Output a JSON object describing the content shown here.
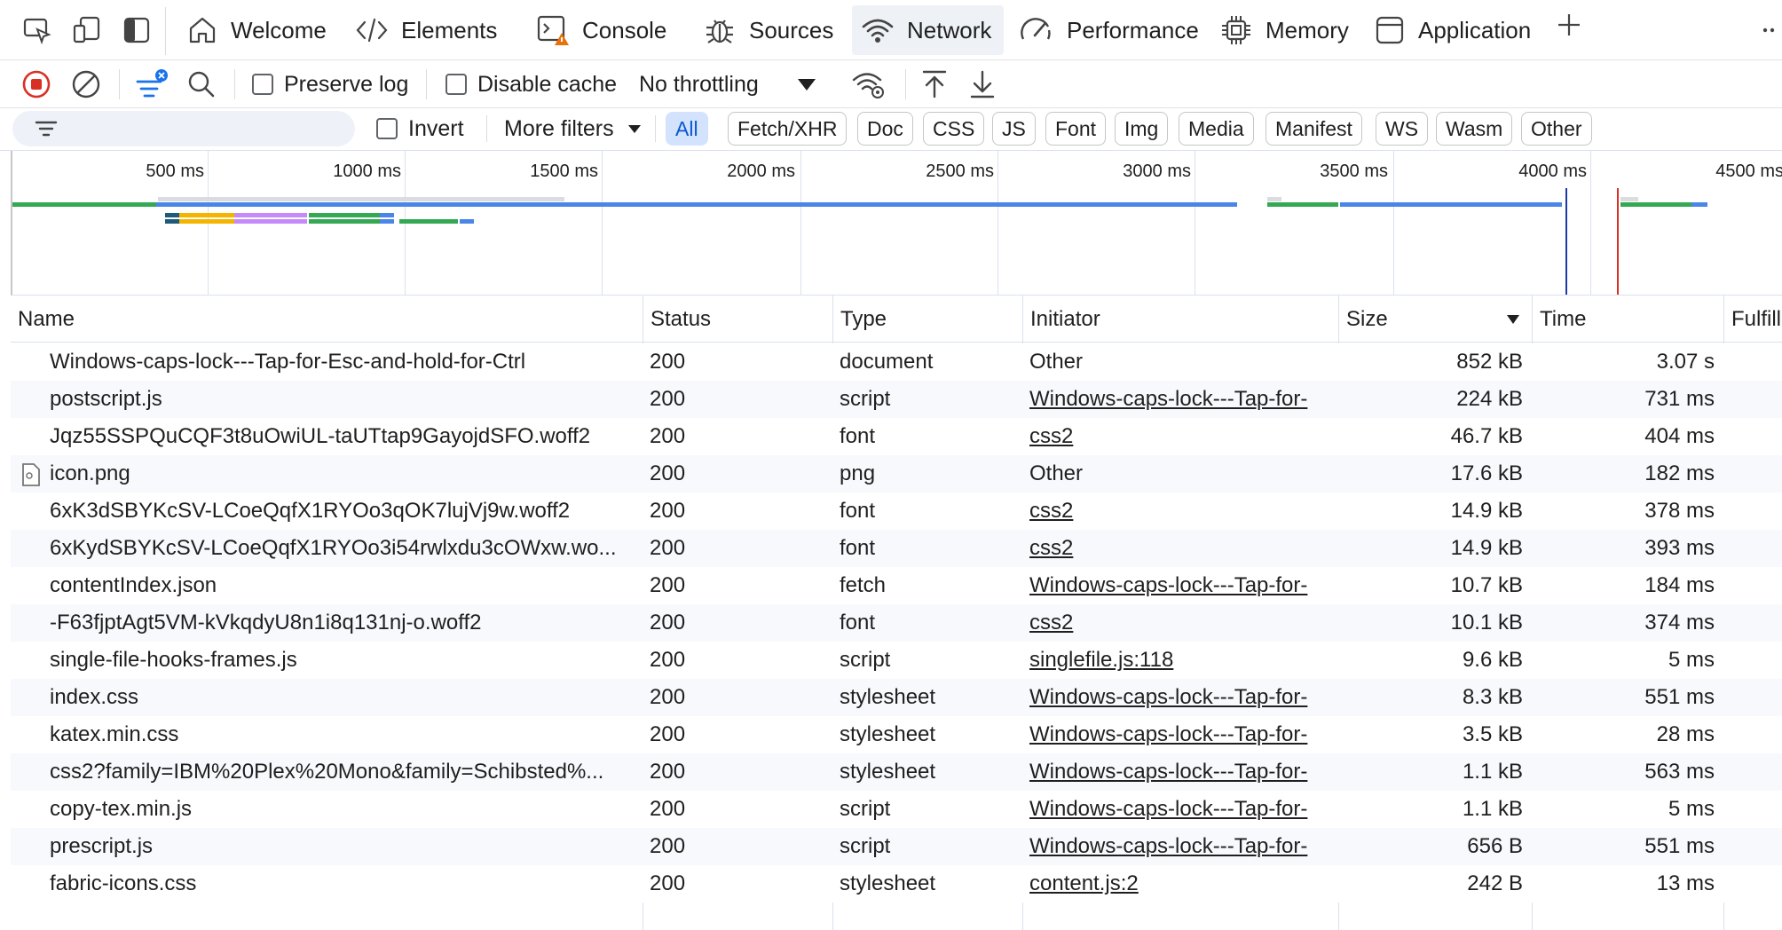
{
  "tabs": [
    {
      "label": "Welcome",
      "icon": "home-icon"
    },
    {
      "label": "Elements",
      "icon": "code-icon"
    },
    {
      "label": "Console",
      "icon": "console-warning-icon"
    },
    {
      "label": "Sources",
      "icon": "bug-icon"
    },
    {
      "label": "Network",
      "icon": "wifi-icon"
    },
    {
      "label": "Performance",
      "icon": "gauge-icon"
    },
    {
      "label": "Memory",
      "icon": "chip-icon"
    },
    {
      "label": "Application",
      "icon": "window-icon"
    }
  ],
  "toolbar": {
    "preserve_log": "Preserve log",
    "disable_cache": "Disable cache",
    "throttling": "No throttling"
  },
  "filters": {
    "invert": "Invert",
    "more_filters": "More filters",
    "chips": [
      "All",
      "Fetch/XHR",
      "Doc",
      "CSS",
      "JS",
      "Font",
      "Img",
      "Media",
      "Manifest",
      "WS",
      "Wasm",
      "Other"
    ],
    "selected": "All"
  },
  "overview": {
    "ticks": [
      "500 ms",
      "1000 ms",
      "1500 ms",
      "2000 ms",
      "2500 ms",
      "3000 ms",
      "3500 ms",
      "4000 ms",
      "4500 ms"
    ],
    "colors": {
      "dom_content_loaded": "#1a3aa5",
      "load": "#d93025"
    }
  },
  "columns": [
    "Name",
    "Status",
    "Type",
    "Initiator",
    "Size",
    "Time",
    "Fulfill"
  ],
  "rows": [
    {
      "name": "Windows-caps-lock---Tap-for-Esc-and-hold-for-Ctrl",
      "status": "200",
      "type": "document",
      "initiator": "Other",
      "size": "852 kB",
      "time": "3.07 s"
    },
    {
      "name": "postscript.js",
      "status": "200",
      "type": "script",
      "initiator": "Windows-caps-lock---Tap-for-",
      "size": "224 kB",
      "time": "731 ms"
    },
    {
      "name": "Jqz55SSPQuCQF3t8uOwiUL-taUTtap9GayojdSFO.woff2",
      "status": "200",
      "type": "font",
      "initiator": "css2",
      "size": "46.7 kB",
      "time": "404 ms"
    },
    {
      "name": "icon.png",
      "status": "200",
      "type": "png",
      "initiator": "Other",
      "size": "17.6 kB",
      "time": "182 ms"
    },
    {
      "name": "6xK3dSBYKcSV-LCoeQqfX1RYOo3qOK7lujVj9w.woff2",
      "status": "200",
      "type": "font",
      "initiator": "css2",
      "size": "14.9 kB",
      "time": "378 ms"
    },
    {
      "name": "6xKydSBYKcSV-LCoeQqfX1RYOo3i54rwlxdu3cOWxw.wo...",
      "status": "200",
      "type": "font",
      "initiator": "css2",
      "size": "14.9 kB",
      "time": "393 ms"
    },
    {
      "name": "contentIndex.json",
      "status": "200",
      "type": "fetch",
      "initiator": "Windows-caps-lock---Tap-for-",
      "size": "10.7 kB",
      "time": "184 ms"
    },
    {
      "name": "-F63fjptAgt5VM-kVkqdyU8n1i8q131nj-o.woff2",
      "status": "200",
      "type": "font",
      "initiator": "css2",
      "size": "10.1 kB",
      "time": "374 ms"
    },
    {
      "name": "single-file-hooks-frames.js",
      "status": "200",
      "type": "script",
      "initiator": "singlefile.js:118",
      "size": "9.6 kB",
      "time": "5 ms"
    },
    {
      "name": "index.css",
      "status": "200",
      "type": "stylesheet",
      "initiator": "Windows-caps-lock---Tap-for-",
      "size": "8.3 kB",
      "time": "551 ms"
    },
    {
      "name": "katex.min.css",
      "status": "200",
      "type": "stylesheet",
      "initiator": "Windows-caps-lock---Tap-for-",
      "size": "3.5 kB",
      "time": "28 ms"
    },
    {
      "name": "css2?family=IBM%20Plex%20Mono&family=Schibsted%...",
      "status": "200",
      "type": "stylesheet",
      "initiator": "Windows-caps-lock---Tap-for-",
      "size": "1.1 kB",
      "time": "563 ms"
    },
    {
      "name": "copy-tex.min.js",
      "status": "200",
      "type": "script",
      "initiator": "Windows-caps-lock---Tap-for-",
      "size": "1.1 kB",
      "time": "5 ms"
    },
    {
      "name": "prescript.js",
      "status": "200",
      "type": "script",
      "initiator": "Windows-caps-lock---Tap-for-",
      "size": "656 B",
      "time": "551 ms"
    },
    {
      "name": "fabric-icons.css",
      "status": "200",
      "type": "stylesheet",
      "initiator": "content.js:2",
      "size": "242 B",
      "time": "13 ms"
    }
  ]
}
